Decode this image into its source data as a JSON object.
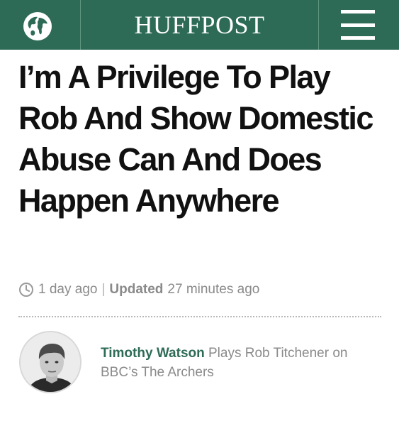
{
  "header": {
    "brand": "HUFFPOST",
    "edition_icon": "globe-icon",
    "menu_icon": "hamburger-menu-icon",
    "background_color": "#2e6b57"
  },
  "article": {
    "headline": "I’m A Privilege To Play Rob And Show Domestic Abuse Can And Does Happen Anywhere",
    "published": "1 day ago",
    "separator": "|",
    "updated_label": "Updated",
    "updated": "27 minutes ago"
  },
  "author": {
    "name": "Timothy Watson",
    "bio": " Plays Rob Titchener on BBC’s The Archers",
    "name_color": "#2e6b57"
  }
}
